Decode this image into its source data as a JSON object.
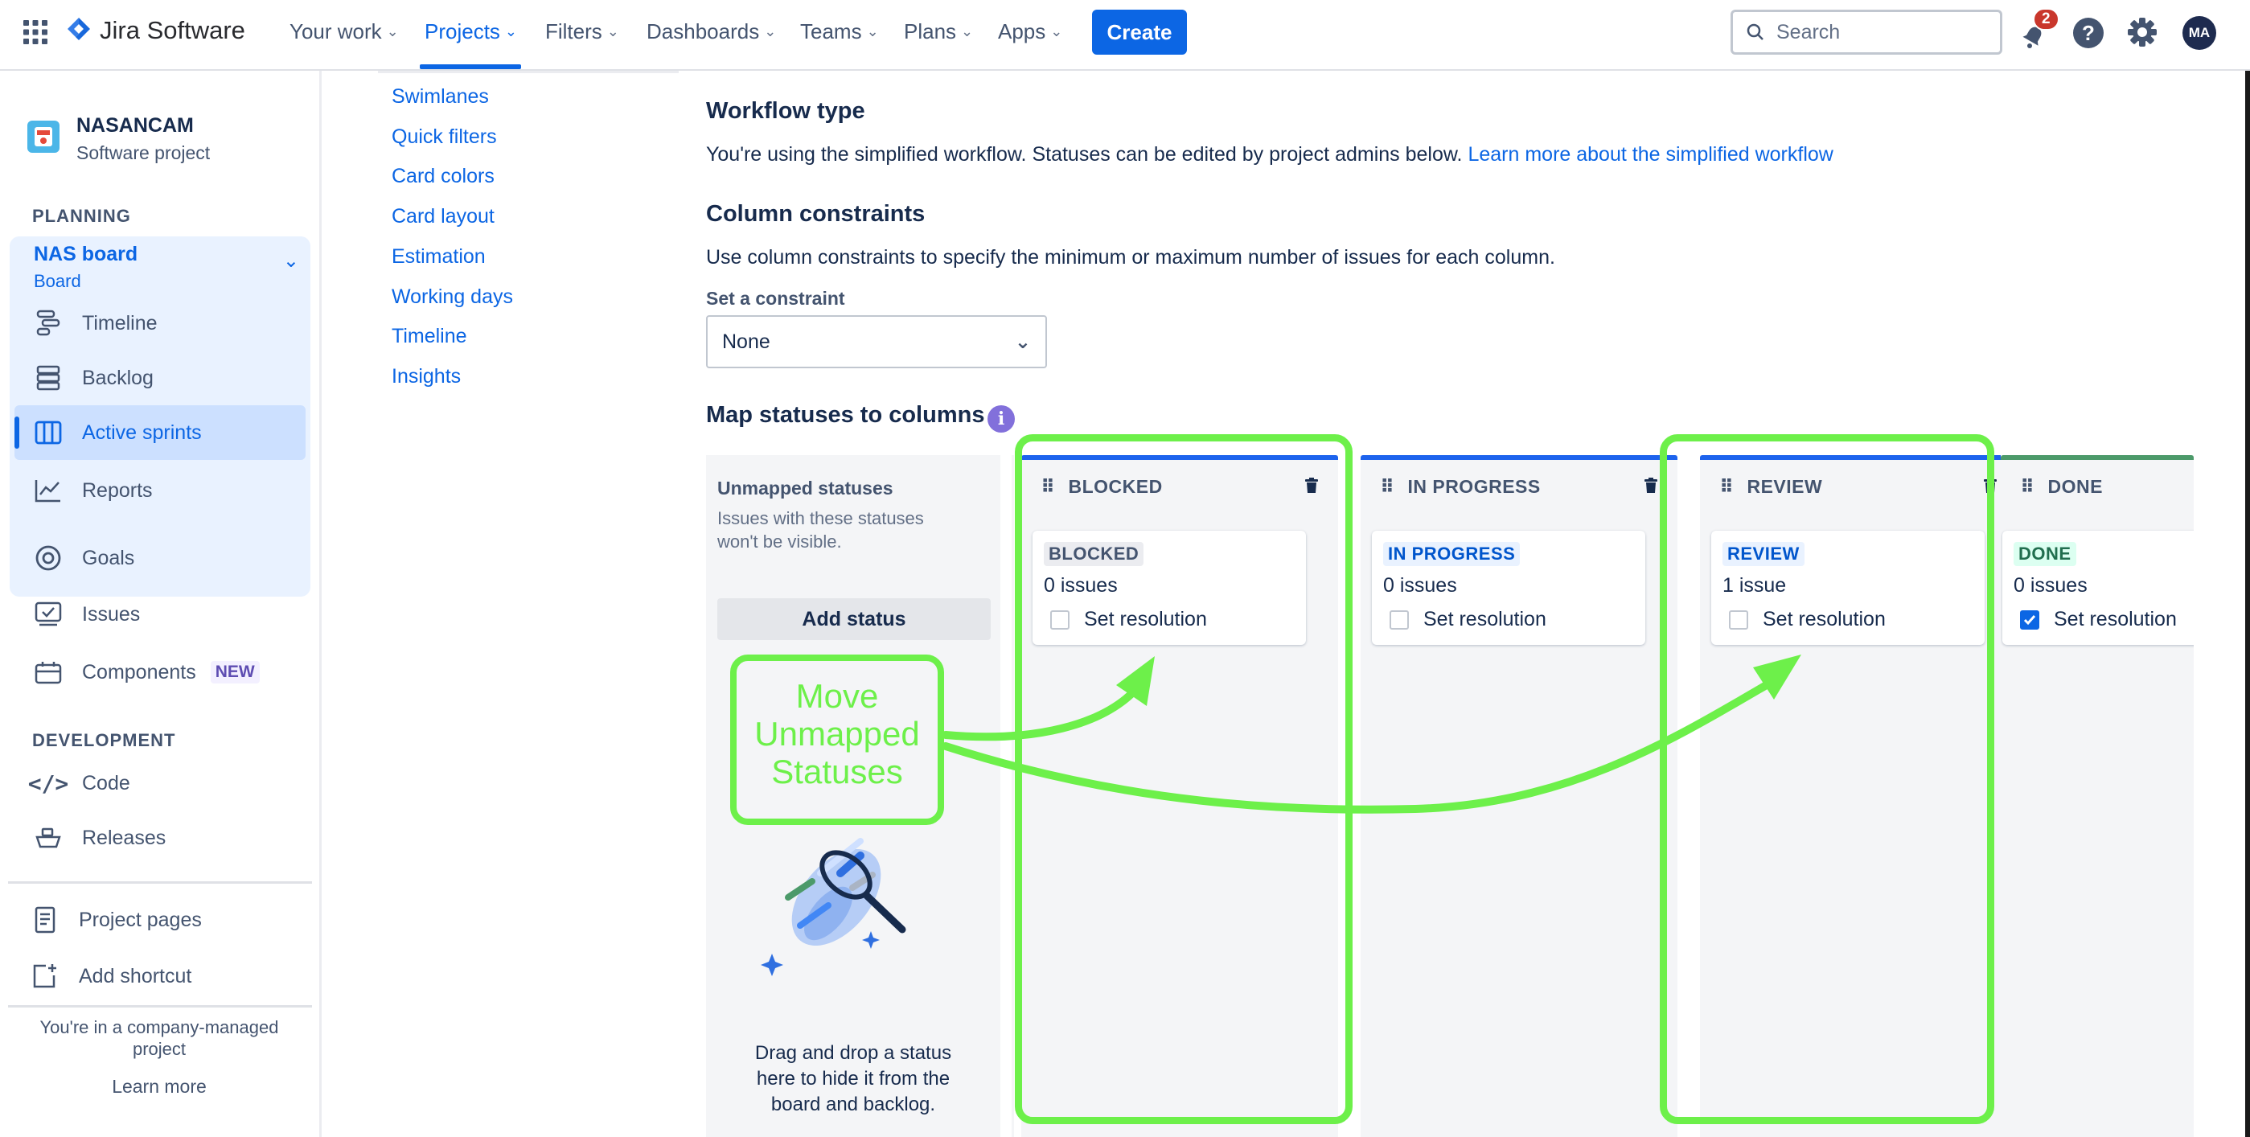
{
  "topnav": {
    "product": "Jira Software",
    "items": [
      {
        "label": "Your work"
      },
      {
        "label": "Projects"
      },
      {
        "label": "Filters"
      },
      {
        "label": "Dashboards"
      },
      {
        "label": "Teams"
      },
      {
        "label": "Plans"
      },
      {
        "label": "Apps"
      }
    ],
    "create_label": "Create",
    "search_placeholder": "Search",
    "notifications_count": "2",
    "avatar_initials": "MA"
  },
  "sidebar": {
    "project_name": "NASANCAM",
    "project_type": "Software project",
    "planning_label": "PLANNING",
    "board_name": "NAS board",
    "board_sub": "Board",
    "planning_items": [
      {
        "label": "Timeline"
      },
      {
        "label": "Backlog"
      },
      {
        "label": "Active sprints"
      },
      {
        "label": "Reports"
      }
    ],
    "other_items": [
      {
        "label": "Goals"
      },
      {
        "label": "Issues"
      },
      {
        "label": "Components"
      }
    ],
    "new_badge": "NEW",
    "development_label": "DEVELOPMENT",
    "dev_items": [
      {
        "label": "Code"
      },
      {
        "label": "Releases"
      }
    ],
    "project_pages": "Project pages",
    "add_shortcut": "Add shortcut",
    "footer_line1": "You're in a company-managed",
    "footer_line2": "project",
    "learn_more": "Learn more"
  },
  "settings_nav": {
    "links": [
      {
        "label": "Swimlanes"
      },
      {
        "label": "Quick filters"
      },
      {
        "label": "Card colors"
      },
      {
        "label": "Card layout"
      },
      {
        "label": "Estimation"
      },
      {
        "label": "Working days"
      },
      {
        "label": "Timeline"
      },
      {
        "label": "Insights"
      }
    ]
  },
  "main": {
    "workflow_title": "Workflow type",
    "workflow_text": "You're using the simplified workflow. Statuses can be edited by project admins below.",
    "workflow_link": "Learn more about the simplified workflow",
    "constraints_title": "Column constraints",
    "constraints_text": "Use column constraints to specify the minimum or maximum number of issues for each column.",
    "constraint_label": "Set a constraint",
    "constraint_value": "None",
    "map_title": "Map statuses to columns",
    "unmapped": {
      "title": "Unmapped statuses",
      "desc_line1": "Issues with these statuses",
      "desc_line2": "won't be visible.",
      "add_status": "Add status",
      "drop_line1": "Drag and drop a status",
      "drop_line2": "here to hide it from the",
      "drop_line3": "board and backlog."
    },
    "columns": [
      {
        "name": "BLOCKED",
        "status": "BLOCKED",
        "count": "0 issues",
        "resolution": "Set resolution",
        "checked": false,
        "bar_color": "#1d63ed",
        "lozenge_bg": "#ebecf0",
        "lozenge_fg": "#44546f"
      },
      {
        "name": "IN PROGRESS",
        "status": "IN PROGRESS",
        "count": "0 issues",
        "resolution": "Set resolution",
        "checked": false,
        "bar_color": "#1d63ed",
        "lozenge_bg": "#e9f2ff",
        "lozenge_fg": "#0055cc"
      },
      {
        "name": "REVIEW",
        "status": "REVIEW",
        "count": "1 issue",
        "resolution": "Set resolution",
        "checked": false,
        "bar_color": "#1d63ed",
        "lozenge_bg": "#e9f2ff",
        "lozenge_fg": "#0055cc"
      },
      {
        "name": "DONE",
        "status": "DONE",
        "count": "0 issues",
        "resolution": "Set resolution",
        "checked": true,
        "bar_color": "#4c9a6a",
        "lozenge_bg": "#dcfff1",
        "lozenge_fg": "#216e4e"
      }
    ]
  },
  "annotation": {
    "line1": "Move",
    "line2": "Unmapped",
    "line3": "Statuses",
    "color": "#6df04a"
  }
}
